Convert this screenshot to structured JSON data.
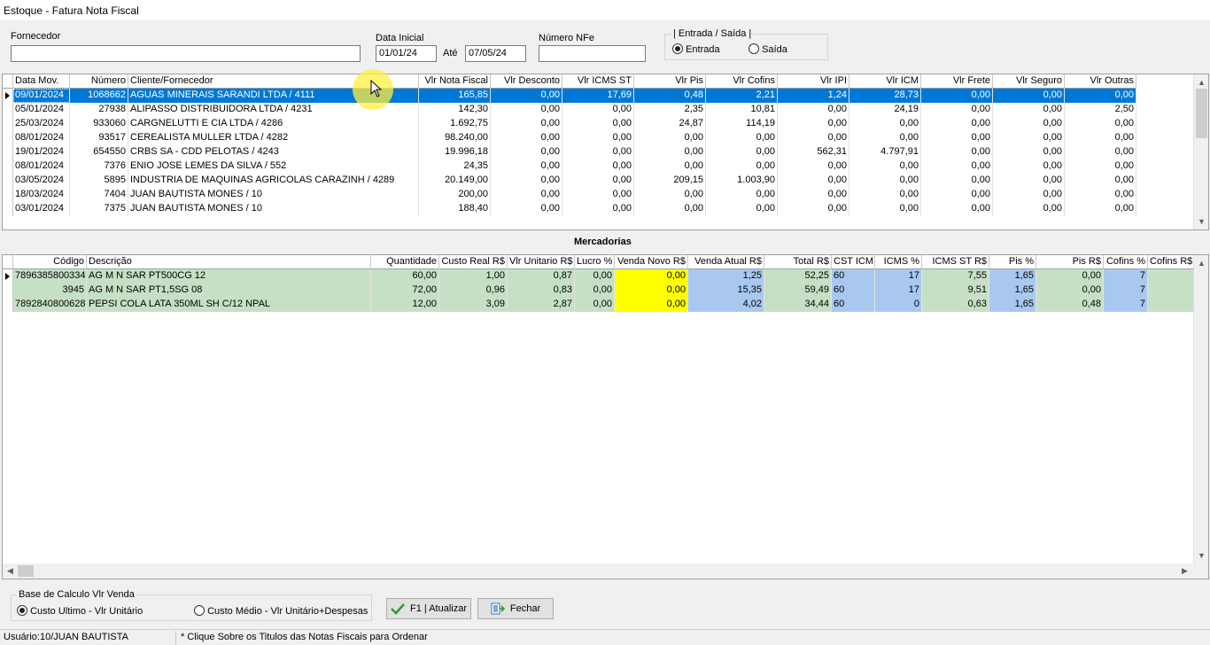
{
  "window": {
    "title": "Estoque - Fatura Nota Fiscal"
  },
  "filters": {
    "fornecedor_label": "Fornecedor",
    "fornecedor_value": "",
    "data_inicial_label": "Data Inicial",
    "data_inicial": "01/01/24",
    "ate_label": "Até",
    "data_final": "07/05/24",
    "numero_nfe_label": "Número NFe",
    "numero_nfe": "",
    "group_label": "| Entrada / Saída |",
    "entrada": "Entrada",
    "saida": "Saída",
    "selected": "Entrada"
  },
  "notas": {
    "columns": [
      "Data Mov.",
      "Número",
      "Cliente/Fornecedor",
      "Vlr Nota Fiscal",
      "Vlr Desconto",
      "Vlr ICMS ST",
      "Vlr Pis",
      "Vlr Cofins",
      "Vlr IPI",
      "Vlr ICM",
      "Vlr Frete",
      "Vlr Seguro",
      "Vlr Outras"
    ],
    "rows": [
      [
        "09/01/2024",
        "1068662",
        "AGUAS MINERAIS SARANDI LTDA / 4111",
        "165,85",
        "0,00",
        "17,69",
        "0,48",
        "2,21",
        "1,24",
        "28,73",
        "0,00",
        "0,00",
        "0,00"
      ],
      [
        "05/01/2024",
        "27938",
        "ALIPASSO DISTRIBUIDORA LTDA / 4231",
        "142,30",
        "0,00",
        "0,00",
        "2,35",
        "10,81",
        "0,00",
        "24,19",
        "0,00",
        "0,00",
        "2,50"
      ],
      [
        "25/03/2024",
        "933060",
        "CARGNELUTTI E CIA LTDA / 4286",
        "1.692,75",
        "0,00",
        "0,00",
        "24,87",
        "114,19",
        "0,00",
        "0,00",
        "0,00",
        "0,00",
        "0,00"
      ],
      [
        "08/01/2024",
        "93517",
        "CEREALISTA MULLER LTDA / 4282",
        "98.240,00",
        "0,00",
        "0,00",
        "0,00",
        "0,00",
        "0,00",
        "0,00",
        "0,00",
        "0,00",
        "0,00"
      ],
      [
        "19/01/2024",
        "654550",
        "CRBS SA - CDD PELOTAS / 4243",
        "19.996,18",
        "0,00",
        "0,00",
        "0,00",
        "0,00",
        "562,31",
        "4.797,91",
        "0,00",
        "0,00",
        "0,00"
      ],
      [
        "08/01/2024",
        "7376",
        "ENIO JOSE LEMES DA SILVA / 552",
        "24,35",
        "0,00",
        "0,00",
        "0,00",
        "0,00",
        "0,00",
        "0,00",
        "0,00",
        "0,00",
        "0,00"
      ],
      [
        "03/05/2024",
        "5895",
        "INDUSTRIA DE MAQUINAS AGRICOLAS CARAZINH / 4289",
        "20.149,00",
        "0,00",
        "0,00",
        "209,15",
        "1.003,90",
        "0,00",
        "0,00",
        "0,00",
        "0,00",
        "0,00"
      ],
      [
        "18/03/2024",
        "7404",
        "JUAN BAUTISTA MONES / 10",
        "200,00",
        "0,00",
        "0,00",
        "0,00",
        "0,00",
        "0,00",
        "0,00",
        "0,00",
        "0,00",
        "0,00"
      ],
      [
        "03/01/2024",
        "7375",
        "JUAN BAUTISTA MONES / 10",
        "188,40",
        "0,00",
        "0,00",
        "0,00",
        "0,00",
        "0,00",
        "0,00",
        "0,00",
        "0,00",
        "0,00"
      ]
    ]
  },
  "mercadorias": {
    "title": "Mercadorias",
    "columns": [
      "Código",
      "Descrição",
      "Quantidade",
      "Custo Real R$",
      "Vlr Unitario R$",
      "Lucro %",
      "Venda Novo R$",
      "Venda Atual R$",
      "Total R$",
      "CST ICM",
      "ICMS %",
      "ICMS ST R$",
      "Pis %",
      "Pis R$",
      "Cofins %",
      "Cofins R$"
    ],
    "rows": [
      [
        "7896385800334",
        "AG M N SAR PT500CG 12",
        "60,00",
        "1,00",
        "0,87",
        "0,00",
        "0,00",
        "1,25",
        "52,25",
        "60",
        "17",
        "7,55",
        "1,65",
        "0,00",
        "7",
        ""
      ],
      [
        "3945",
        "AG M N SAR PT1,5SG 08",
        "72,00",
        "0,96",
        "0,83",
        "0,00",
        "0,00",
        "15,35",
        "59,49",
        "60",
        "17",
        "9,51",
        "1,65",
        "0,00",
        "7",
        ""
      ],
      [
        "7892840800628",
        "PEPSI COLA LATA 350ML SH C/12 NPAL",
        "12,00",
        "3,09",
        "2,87",
        "0,00",
        "0,00",
        "4,02",
        "34,44",
        "60",
        "0",
        "0,63",
        "1,65",
        "0,48",
        "7",
        ""
      ]
    ]
  },
  "base_calculo": {
    "label": "Base de Calculo Vlr Venda",
    "opt1": "Custo Ultimo - Vlr Unitário",
    "opt2": "Custo Médio - Vlr Unitário+Despesas",
    "selected": "Custo Ultimo - Vlr Unitário"
  },
  "buttons": {
    "atualizar": "F1 | Atualizar",
    "fechar": "Fechar"
  },
  "status": {
    "usuario": "Usuário:10/JUAN BAUTISTA",
    "hint": "* Clique Sobre os Titulos das Notas Fiscais para Ordenar"
  }
}
